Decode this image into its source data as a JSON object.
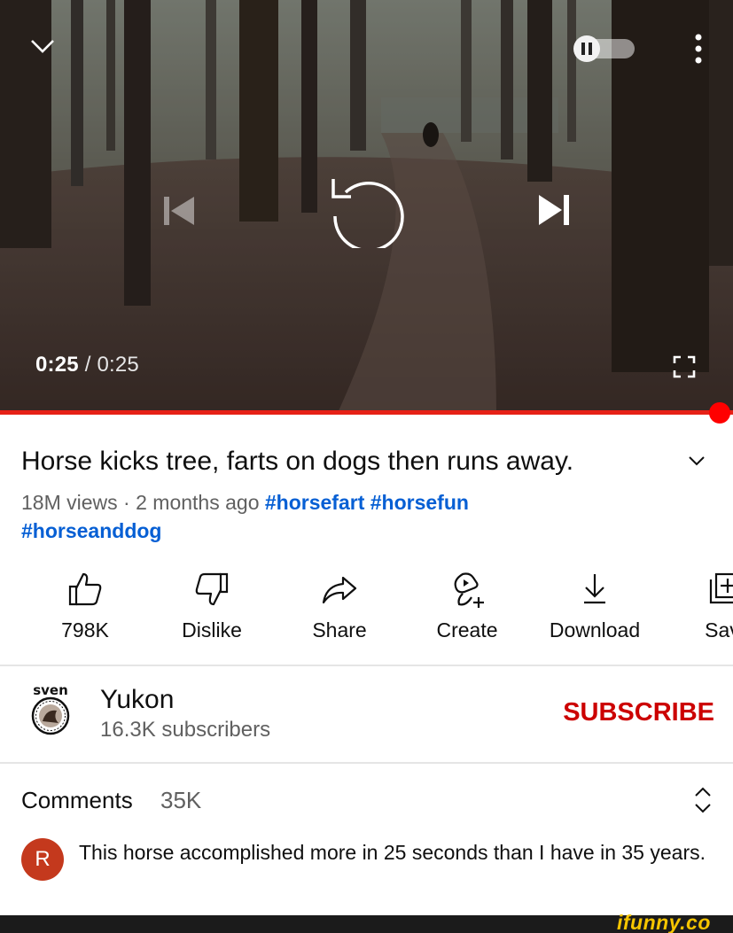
{
  "player": {
    "current_time": "0:25",
    "separator": "/",
    "duration": "0:25",
    "progress": 1.0,
    "autoplay_on": false,
    "accent_color": "#ff0000"
  },
  "video": {
    "title": "Horse kicks tree, farts on dogs then runs away.",
    "views": "18M views",
    "dot": "·",
    "age": "2 months ago",
    "hashtags": [
      "#horsefart",
      "#horsefun",
      "#horseanddog"
    ]
  },
  "actions": [
    {
      "icon": "thumbs-up-icon",
      "label": "798K"
    },
    {
      "icon": "thumbs-down-icon",
      "label": "Dislike"
    },
    {
      "icon": "share-icon",
      "label": "Share"
    },
    {
      "icon": "create-icon",
      "label": "Create"
    },
    {
      "icon": "download-icon",
      "label": "Download"
    },
    {
      "icon": "save-icon",
      "label": "Sav"
    }
  ],
  "channel": {
    "avatar_text": "sven",
    "name": "Yukon",
    "subscribers": "16.3K subscribers",
    "subscribe_label": "SUBSCRIBE"
  },
  "comments": {
    "header": "Comments",
    "count": "35K",
    "top_comment": {
      "avatar_letter": "R",
      "avatar_color": "#c4391d",
      "text": "This horse accomplished more in 25 seconds than I have in 35 years."
    }
  },
  "watermark": "ifunny.co"
}
